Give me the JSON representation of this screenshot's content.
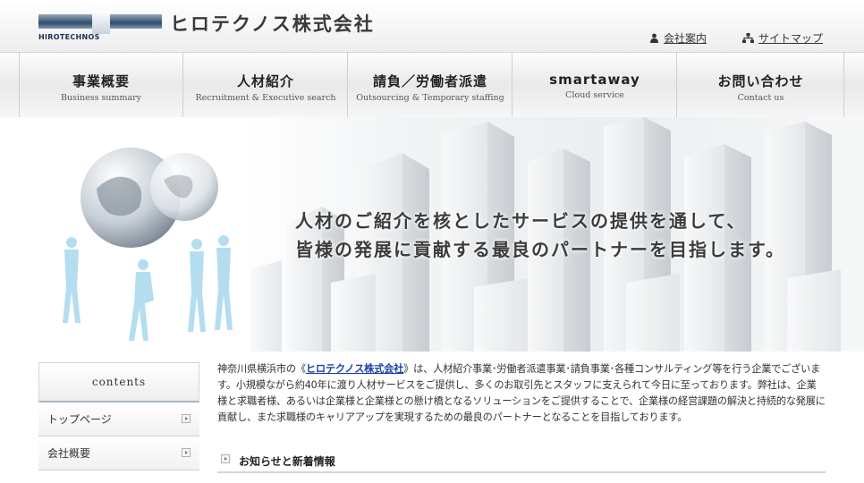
{
  "header": {
    "logo_text": "HIROTECHNOS",
    "company_name": "ヒロテクノス株式会社",
    "links": [
      {
        "label": "会社案内",
        "icon": "person-icon"
      },
      {
        "label": "サイトマップ",
        "icon": "sitemap-icon"
      }
    ]
  },
  "nav": [
    {
      "jp": "事業概要",
      "en": "Business summary"
    },
    {
      "jp": "人材紹介",
      "en": "Recruitment & Executive search"
    },
    {
      "jp": "請負／労働者派遣",
      "en": "Outsourcing & Temporary staffing"
    },
    {
      "jp": "smartaway",
      "en": "Cloud service"
    },
    {
      "jp": "お問い合わせ",
      "en": "Contact us"
    }
  ],
  "hero": {
    "line1": "人材のご紹介を核としたサービスの提供を通して、",
    "line2": "皆様の発展に貢献する最良のパートナーを目指します。"
  },
  "sidebar": {
    "heading": "contents",
    "items": [
      {
        "label": "トップページ"
      },
      {
        "label": "会社概要"
      }
    ]
  },
  "intro": {
    "before": "神奈川県横浜市の",
    "open_bracket": "《",
    "link": "ヒロテクノス株式会社",
    "close_bracket": "》",
    "after": "は、人材紹介事業･労働者派遣事業･請負事業･各種コンサルティング等を行う企業でございます。小規模ながら約40年に渡り人材サービスをご提供し、多くのお取引先とスタッフに支えられて今日に至っております。弊社は、企業様と求職者様、あるいは企業様と企業様との懸け橋となるソリューションをご提供することで、企業様の経営課題の解決と持続的な発展に貢献し、また求職様のキャリアアップを実現するための最良のパートナーとなることを目指しております。"
  },
  "news": {
    "title": "お知らせと新着情報"
  },
  "colors": {
    "link": "#1a3fa8",
    "accent_line": "#a7b5c3"
  }
}
